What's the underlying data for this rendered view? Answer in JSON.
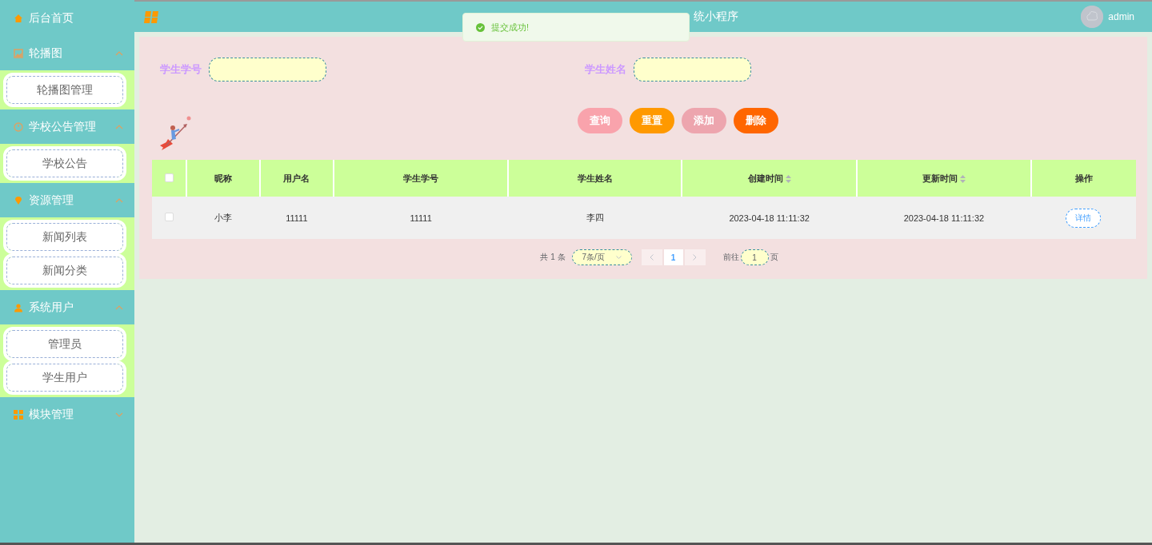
{
  "sidebar": {
    "items": [
      {
        "label": "后台首页"
      },
      {
        "label": "轮播图",
        "expanded": true,
        "children": [
          {
            "label": "轮播图管理"
          }
        ]
      },
      {
        "label": "学校公告管理",
        "expanded": true,
        "children": [
          {
            "label": "学校公告"
          }
        ]
      },
      {
        "label": "资源管理",
        "expanded": true,
        "children": [
          {
            "label": "新闻列表"
          },
          {
            "label": "新闻分类"
          }
        ]
      },
      {
        "label": "系统用户",
        "expanded": true,
        "children": [
          {
            "label": "管理员"
          },
          {
            "label": "学生用户"
          }
        ]
      },
      {
        "label": "模块管理",
        "expanded": false
      }
    ]
  },
  "header": {
    "title": "统小程序",
    "user": "admin"
  },
  "toast": {
    "message": "提交成功!"
  },
  "search": {
    "fields": [
      {
        "label": "学生学号"
      },
      {
        "label": "学生姓名"
      }
    ],
    "buttons": [
      {
        "label": "查询",
        "color": "#f9a3ac"
      },
      {
        "label": "重置",
        "color": "#ff9900"
      },
      {
        "label": "添加",
        "color": "#eda5ae"
      },
      {
        "label": "删除",
        "color": "#ff6600"
      }
    ]
  },
  "table": {
    "select_all": {
      "checked": false
    },
    "columns": [
      {
        "label": "昵称",
        "sortable": false
      },
      {
        "label": "用户名",
        "sortable": false
      },
      {
        "label": "学生学号",
        "sortable": false
      },
      {
        "label": "学生姓名",
        "sortable": false
      },
      {
        "label": "创建时间",
        "sortable": true
      },
      {
        "label": "更新时间",
        "sortable": true
      },
      {
        "label": "操作",
        "sortable": false
      }
    ],
    "rows": [
      {
        "checked": false,
        "cells": [
          "小李",
          "11111",
          "11111",
          "李四",
          "2023-04-18 11:11:32",
          "2023-04-18 11:11:32"
        ],
        "action": "详情"
      }
    ]
  },
  "pagination": {
    "total": "共 1 条",
    "page_size": "7条/页",
    "pages": [
      {
        "label": "1",
        "selected": true
      }
    ],
    "goto_label": "前往",
    "goto_value": "1",
    "goto_suffix": "页"
  }
}
